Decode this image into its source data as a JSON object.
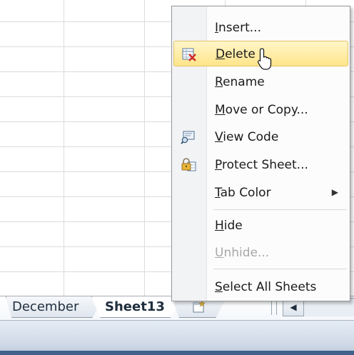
{
  "context_menu": {
    "items": [
      {
        "label": "Insert...",
        "mnemonic": "I",
        "icon": null
      },
      {
        "label": "Delete",
        "mnemonic": "D",
        "icon": "delete-sheet-icon",
        "highlighted": true
      },
      {
        "label": "Rename",
        "mnemonic": "R",
        "icon": null
      },
      {
        "label": "Move or Copy...",
        "mnemonic": "M",
        "icon": null
      },
      {
        "label": "View Code",
        "mnemonic": "V",
        "icon": "view-code-icon"
      },
      {
        "label": "Protect Sheet...",
        "mnemonic": "P",
        "icon": "protect-sheet-icon"
      },
      {
        "label": "Tab Color",
        "mnemonic": "T",
        "icon": null,
        "submenu": true
      },
      {
        "label": "Hide",
        "mnemonic": "H",
        "icon": null
      },
      {
        "label": "Unhide...",
        "mnemonic": "U",
        "icon": null,
        "disabled": true
      },
      {
        "label": "Select All Sheets",
        "mnemonic": "S",
        "icon": null
      }
    ]
  },
  "sheet_tabs": {
    "tabs": [
      {
        "label": "December",
        "active": false
      },
      {
        "label": "Sheet13",
        "active": true
      }
    ],
    "insert_tab_icon": "insert-worksheet-icon"
  },
  "colors": {
    "highlight": "#ffe58a",
    "highlight_border": "#e5c365",
    "grid_line": "#dadcdd",
    "status_bar": "#cfd9e6"
  }
}
